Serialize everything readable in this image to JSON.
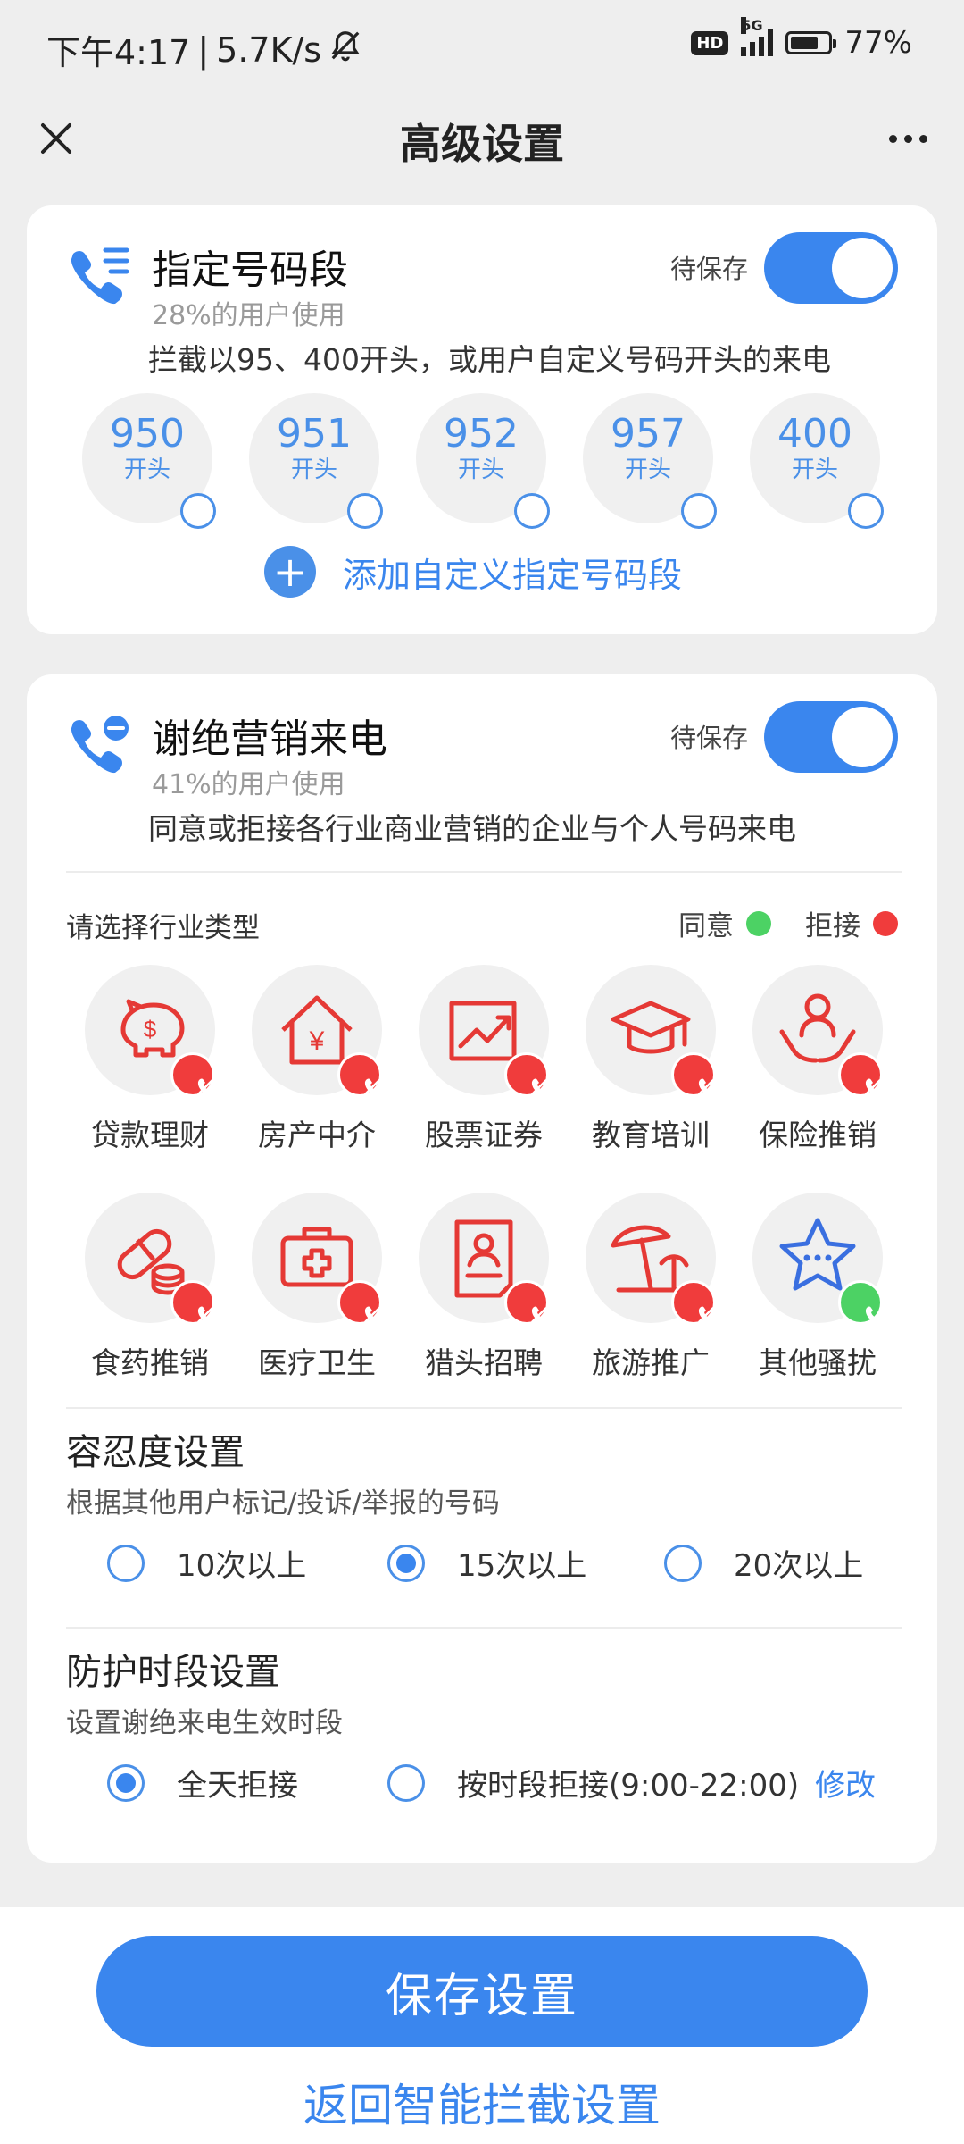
{
  "status": {
    "time": "下午4:17",
    "net_speed": "5.7K/s",
    "hd": "HD",
    "network": "5G",
    "battery": "77%",
    "battery_level": 0.77
  },
  "appbar": {
    "title": "高级设置"
  },
  "section_range": {
    "title": "指定号码段",
    "usage": "28%的用户使用",
    "status": "待保存",
    "enabled": true,
    "description": "拦截以95、400开头，或用户自定义号码开头的来电",
    "prefixes": [
      {
        "number": "950",
        "label": "开头"
      },
      {
        "number": "951",
        "label": "开头"
      },
      {
        "number": "952",
        "label": "开头"
      },
      {
        "number": "957",
        "label": "开头"
      },
      {
        "number": "400",
        "label": "开头"
      }
    ],
    "add_label": "添加自定义指定号码段"
  },
  "section_marketing": {
    "title": "谢绝营销来电",
    "usage": "41%的用户使用",
    "status": "待保存",
    "enabled": true,
    "description": "同意或拒接各行业商业营销的企业与个人号码来电",
    "select_label": "请选择行业类型",
    "legend_agree": "同意",
    "legend_reject": "拒接",
    "colors": {
      "agree": "#4cd264",
      "reject": "#f03c3c",
      "accent": "#3a86ee"
    },
    "industries": [
      {
        "label": "贷款理财",
        "icon": "piggy-bank-icon",
        "state": "reject"
      },
      {
        "label": "房产中介",
        "icon": "house-yuan-icon",
        "state": "reject"
      },
      {
        "label": "股票证券",
        "icon": "stock-chart-icon",
        "state": "reject"
      },
      {
        "label": "教育培训",
        "icon": "graduation-cap-icon",
        "state": "reject"
      },
      {
        "label": "保险推销",
        "icon": "insurance-hands-icon",
        "state": "reject"
      },
      {
        "label": "食药推销",
        "icon": "pill-icon",
        "state": "reject"
      },
      {
        "label": "医疗卫生",
        "icon": "medical-kit-icon",
        "state": "reject"
      },
      {
        "label": "猎头招聘",
        "icon": "resume-icon",
        "state": "reject"
      },
      {
        "label": "旅游推广",
        "icon": "beach-umbrella-icon",
        "state": "reject"
      },
      {
        "label": "其他骚扰",
        "icon": "star-chat-icon",
        "state": "agree"
      }
    ]
  },
  "tolerance": {
    "title": "容忍度设置",
    "subtitle": "根据其他用户标记/投诉/举报的号码",
    "options": [
      "10次以上",
      "15次以上",
      "20次以上"
    ],
    "selected": "15次以上"
  },
  "protection": {
    "title": "防护时段设置",
    "subtitle": "设置谢绝来电生效时段",
    "options": [
      "全天拒接",
      "按时段拒接(9:00-22:00)"
    ],
    "selected": "全天拒接",
    "modify_label": "修改"
  },
  "bottom": {
    "save_label": "保存设置",
    "back_label": "返回智能拦截设置"
  }
}
